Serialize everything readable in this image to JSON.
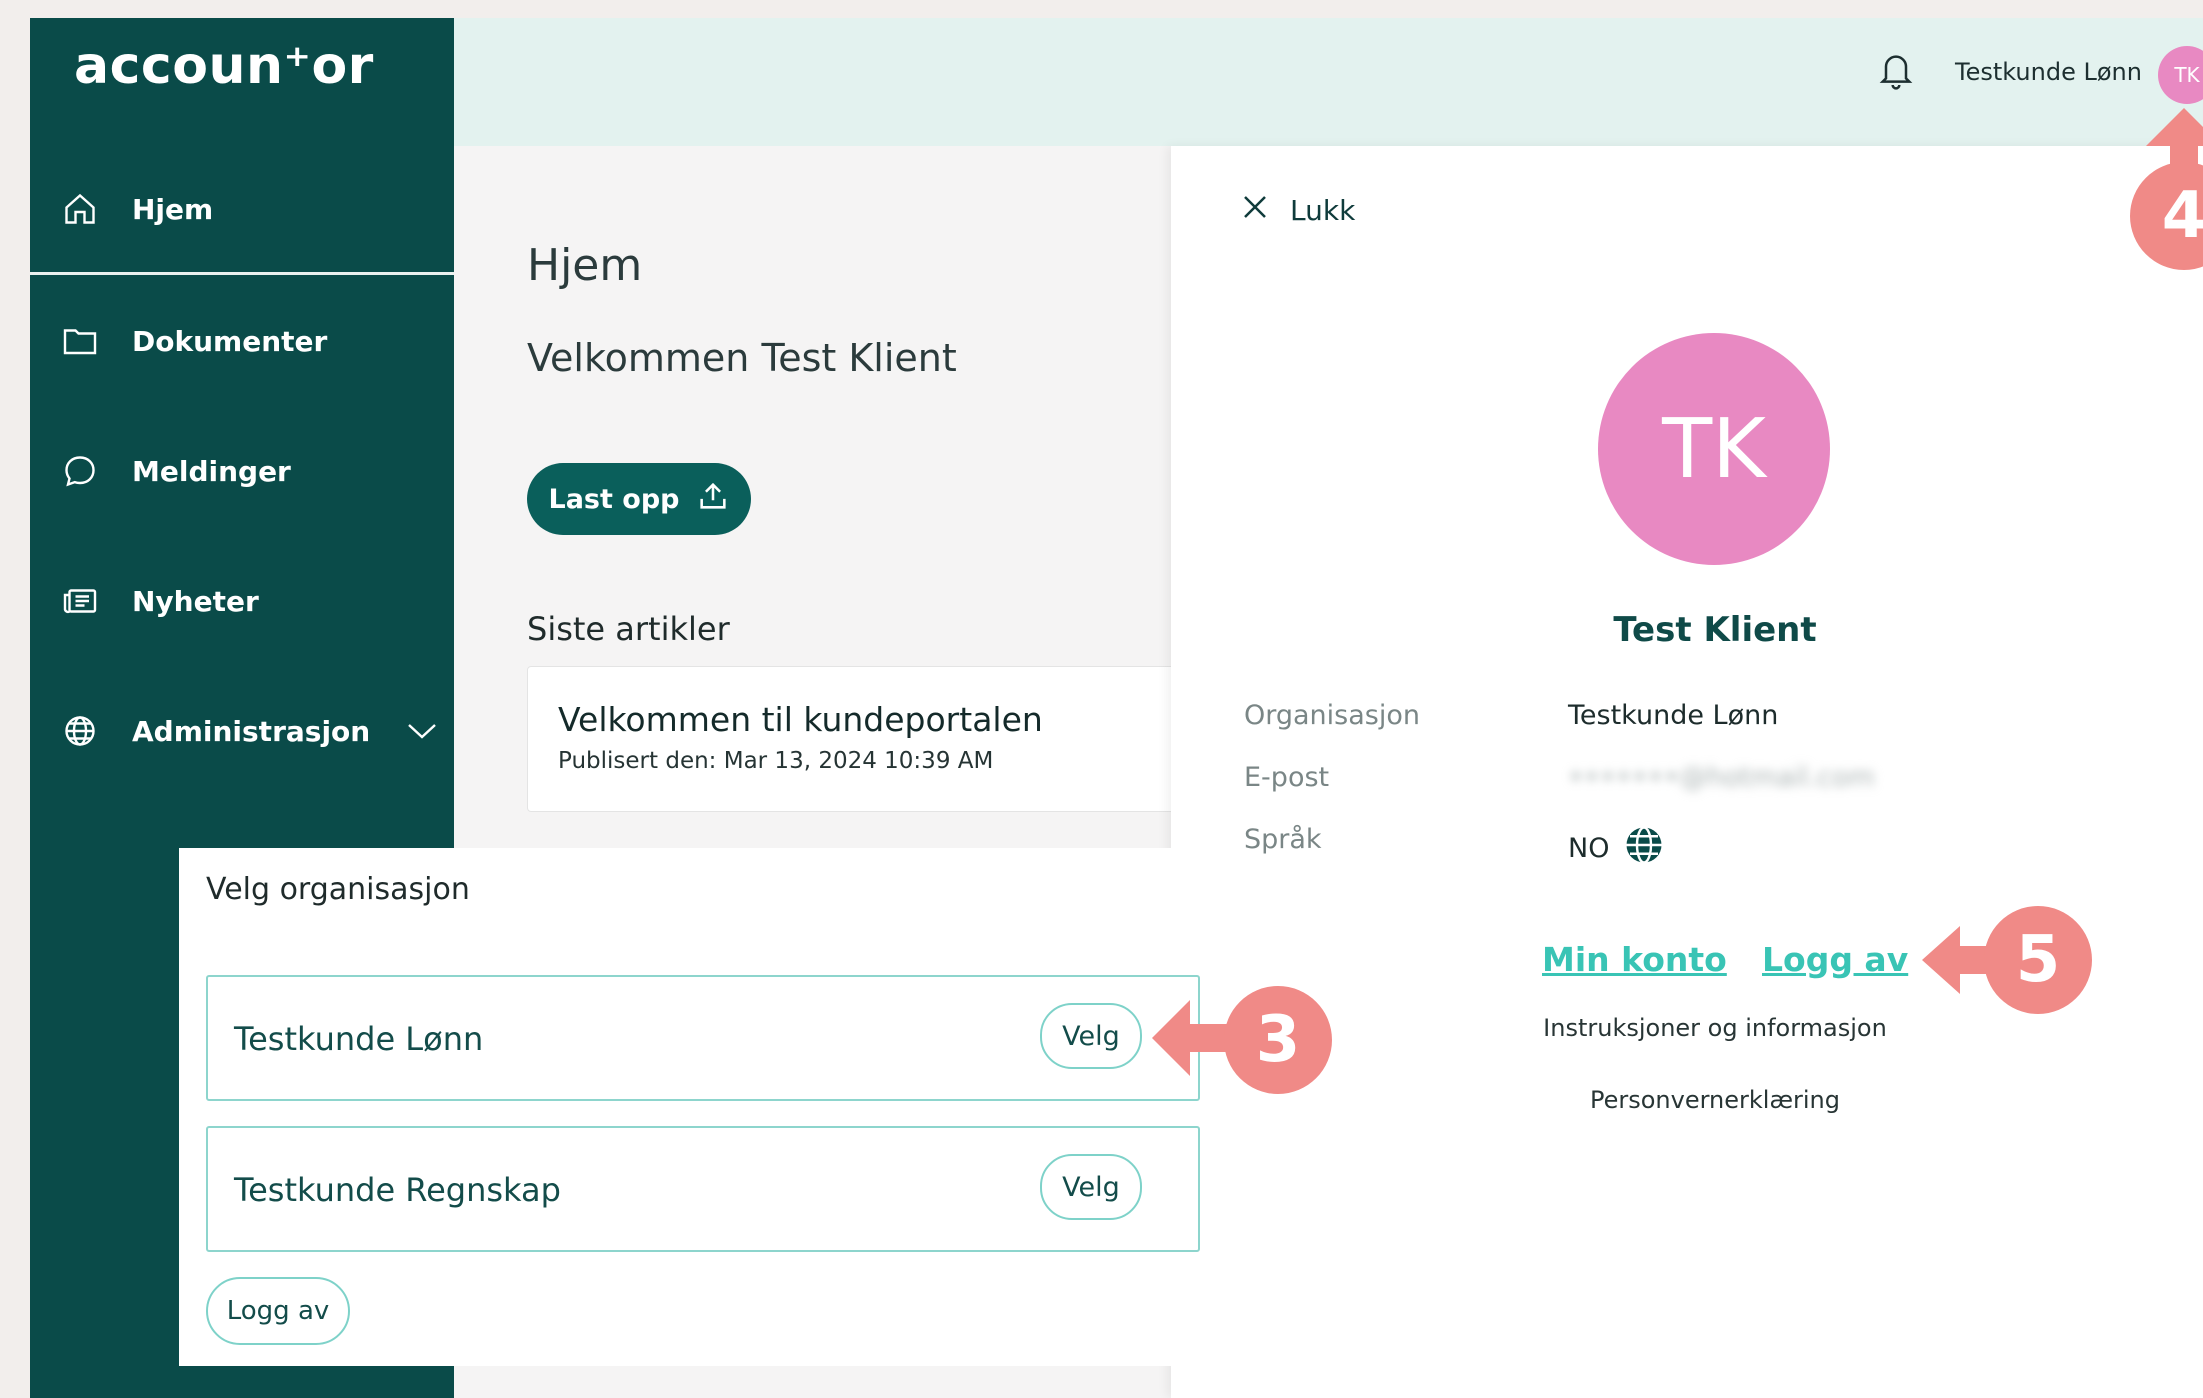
{
  "app": {
    "logo_text": "accoun⁺or"
  },
  "sidebar": {
    "items": [
      {
        "label": "Hjem",
        "icon": "home-icon"
      },
      {
        "label": "Dokumenter",
        "icon": "folder-icon"
      },
      {
        "label": "Meldinger",
        "icon": "message-icon"
      },
      {
        "label": "Nyheter",
        "icon": "newspaper-icon"
      },
      {
        "label": "Administrasjon",
        "icon": "globe-icon"
      }
    ]
  },
  "header": {
    "user_name": "Testkunde Lønn",
    "avatar_initials": "TK"
  },
  "main": {
    "title": "Hjem",
    "welcome": "Velkommen Test Klient",
    "upload_label": "Last opp",
    "articles_heading": "Siste artikler",
    "article": {
      "title": "Velkommen til kundeportalen",
      "published": "Publisert den: Mar 13, 2024 10:39 AM"
    }
  },
  "profile": {
    "close_label": "Lukk",
    "initials": "TK",
    "name": "Test Klient",
    "org_label": "Organisasjon",
    "org_value": "Testkunde Lønn",
    "email_label": "E-post",
    "email_value": "•••••••@hotmail.com",
    "lang_label": "Språk",
    "lang_value": "NO",
    "account_link": "Min konto",
    "logout_link": "Logg av",
    "instructions_link": "Instruksjoner og informasjon",
    "privacy_link": "Personvernerklæring"
  },
  "org_selector": {
    "title": "Velg organisasjon",
    "organizations": [
      {
        "name": "Testkunde Lønn",
        "button": "Velg"
      },
      {
        "name": "Testkunde Regnskap",
        "button": "Velg"
      }
    ],
    "logout_label": "Logg av"
  },
  "callouts": [
    "3",
    "4",
    "5"
  ],
  "colors": {
    "sidebar": "#0a4b49",
    "accent": "#0a5f5b",
    "link": "#39c4b5",
    "avatar": "#e889c2",
    "callout": "#f08a87"
  }
}
